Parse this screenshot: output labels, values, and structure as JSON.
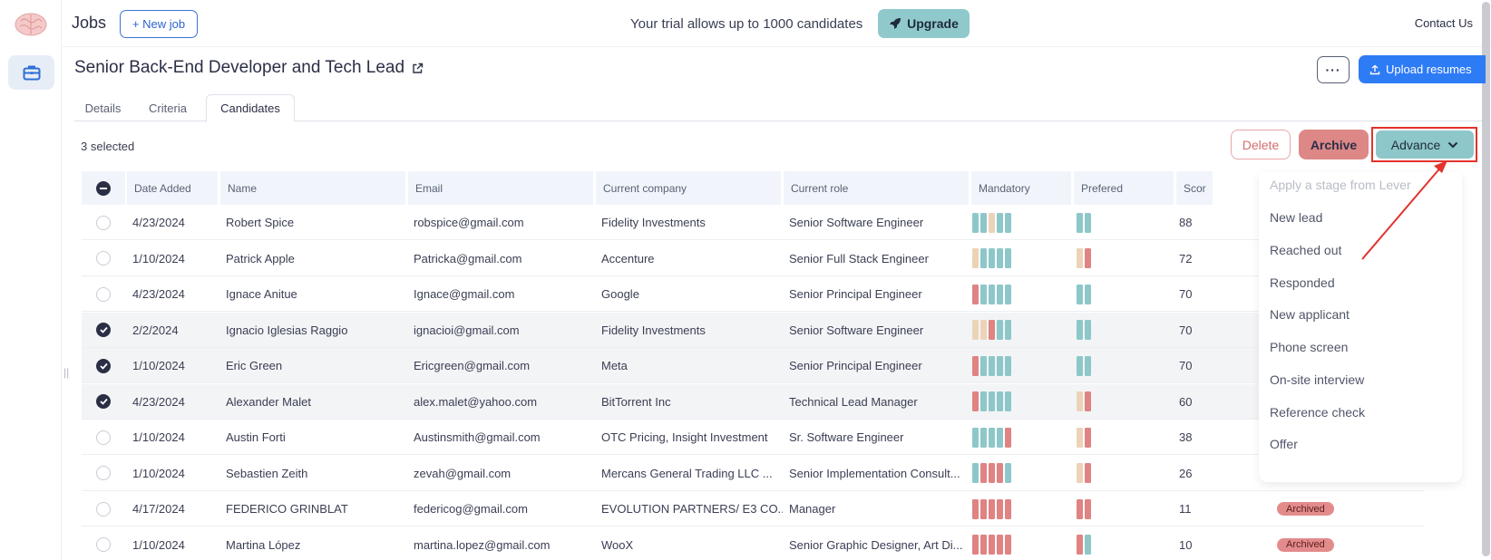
{
  "topbar": {
    "title": "Jobs",
    "new_job_label": "+ New job",
    "trial_text": "Your trial allows up to 1000 candidates",
    "upgrade_label": "Upgrade",
    "contact_label": "Contact Us"
  },
  "job": {
    "title": "Senior Back-End Developer and Tech Lead",
    "more_label": "···",
    "upload_label": "Upload resumes"
  },
  "tabs": [
    {
      "label": "Details"
    },
    {
      "label": "Criteria"
    },
    {
      "label": "Candidates"
    }
  ],
  "selected_text": "3 selected",
  "actions": {
    "delete_label": "Delete",
    "archive_label": "Archive",
    "advance_label": "Advance"
  },
  "columns": [
    "Date Added",
    "Name",
    "Email",
    "Current company",
    "Current role",
    "Mandatory",
    "Prefered",
    "Scor"
  ],
  "colors": {
    "teal": "#8ec7c9",
    "beige": "#ecd3b8",
    "red": "#df8383",
    "brand_blue": "#2e7bf6"
  },
  "rows": [
    {
      "selected": false,
      "date": "4/23/2024",
      "name": "Robert Spice",
      "email": "robspice@gmail.com",
      "company": "Fidelity Investments",
      "role": "Senior Software Engineer",
      "mandatory": [
        "t",
        "t",
        "b",
        "t",
        "t"
      ],
      "prefered": [
        "t",
        "t"
      ],
      "score": "88",
      "status": ""
    },
    {
      "selected": false,
      "date": "1/10/2024",
      "name": "Patrick Apple",
      "email": "Patricka@gmail.com",
      "company": "Accenture",
      "role": "Senior Full Stack Engineer",
      "mandatory": [
        "b",
        "t",
        "t",
        "t",
        "t"
      ],
      "prefered": [
        "b",
        "r"
      ],
      "score": "72",
      "status": ""
    },
    {
      "selected": false,
      "date": "4/23/2024",
      "name": "Ignace Anitue",
      "email": "Ignace@gmail.com",
      "company": "Google",
      "role": "Senior Principal Engineer",
      "mandatory": [
        "r",
        "t",
        "t",
        "t",
        "t"
      ],
      "prefered": [
        "t",
        "t"
      ],
      "score": "70",
      "status": ""
    },
    {
      "selected": true,
      "date": "2/2/2024",
      "name": "Ignacio Iglesias Raggio",
      "email": "ignacioi@gmail.com",
      "company": "Fidelity Investments",
      "role": "Senior Software Engineer",
      "mandatory": [
        "b",
        "b",
        "r",
        "t",
        "t"
      ],
      "prefered": [
        "t",
        "t"
      ],
      "score": "70",
      "status": ""
    },
    {
      "selected": true,
      "date": "1/10/2024",
      "name": "Eric Green",
      "email": "Ericgreen@gmail.com",
      "company": "Meta",
      "role": "Senior Principal Engineer",
      "mandatory": [
        "r",
        "t",
        "t",
        "t",
        "t"
      ],
      "prefered": [
        "t",
        "t"
      ],
      "score": "70",
      "status": ""
    },
    {
      "selected": true,
      "date": "4/23/2024",
      "name": "Alexander Malet",
      "email": "alex.malet@yahoo.com",
      "company": "BitTorrent Inc",
      "role": "Technical Lead Manager",
      "mandatory": [
        "r",
        "t",
        "t",
        "t",
        "t"
      ],
      "prefered": [
        "b",
        "r"
      ],
      "score": "60",
      "status": ""
    },
    {
      "selected": false,
      "date": "1/10/2024",
      "name": "Austin Forti",
      "email": "Austinsmith@gmail.com",
      "company": "OTC Pricing, Insight Investment",
      "role": "Sr. Software Engineer",
      "mandatory": [
        "t",
        "t",
        "t",
        "t",
        "r"
      ],
      "prefered": [
        "b",
        "r"
      ],
      "score": "38",
      "status": ""
    },
    {
      "selected": false,
      "date": "1/10/2024",
      "name": "Sebastien Zeith",
      "email": "zevah@gmail.com",
      "company": "Mercans General Trading LLC ...",
      "role": "Senior Implementation Consult...",
      "mandatory": [
        "t",
        "r",
        "r",
        "r",
        "t"
      ],
      "prefered": [
        "b",
        "r"
      ],
      "score": "26",
      "status": ""
    },
    {
      "selected": false,
      "date": "4/17/2024",
      "name": "FEDERICO GRINBLAT",
      "email": "federicog@gmail.com",
      "company": "EVOLUTION PARTNERS/ E3 CO...",
      "role": "Manager",
      "mandatory": [
        "r",
        "r",
        "r",
        "r",
        "r"
      ],
      "prefered": [
        "r",
        "r"
      ],
      "score": "11",
      "status": "Archived"
    },
    {
      "selected": false,
      "date": "1/10/2024",
      "name": "Martina López",
      "email": "martina.lopez@gmail.com",
      "company": "WooX",
      "role": "Senior Graphic Designer, Art Di...",
      "mandatory": [
        "r",
        "r",
        "r",
        "r",
        "r"
      ],
      "prefered": [
        "r",
        "t"
      ],
      "score": "10",
      "status": "Archived"
    }
  ],
  "advance_menu": {
    "header": "Apply a stage from Lever",
    "items": [
      "New lead",
      "Reached out",
      "Responded",
      "New applicant",
      "Phone screen",
      "On-site interview",
      "Reference check",
      "Offer"
    ]
  }
}
